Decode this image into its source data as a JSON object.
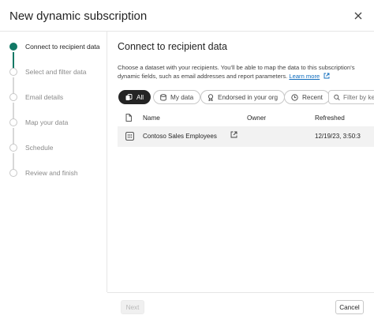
{
  "dialog": {
    "title": "New dynamic subscription",
    "close_icon": "close-icon"
  },
  "steps": [
    {
      "label": "Connect to recipient data",
      "state": "current"
    },
    {
      "label": "Select and filter data",
      "state": "upcoming"
    },
    {
      "label": "Email details",
      "state": "upcoming"
    },
    {
      "label": "Map your data",
      "state": "upcoming"
    },
    {
      "label": "Schedule",
      "state": "upcoming"
    },
    {
      "label": "Review and finish",
      "state": "upcoming"
    }
  ],
  "main": {
    "title": "Connect to recipient data",
    "description": "Choose a dataset with your recipients. You'll be able to map the data to this subscription's dynamic fields, such as email addresses and report parameters.",
    "learn_more": "Learn more",
    "filters": [
      {
        "label": "All",
        "icon": "all-icon",
        "selected": true
      },
      {
        "label": "My data",
        "icon": "database-icon",
        "selected": false
      },
      {
        "label": "Endorsed in your org",
        "icon": "endorsed-icon",
        "selected": false
      },
      {
        "label": "Recent",
        "icon": "clock-icon",
        "selected": false
      }
    ],
    "search_placeholder": "Filter by keyword"
  },
  "table": {
    "columns": [
      "",
      "Name",
      "Owner",
      "Refreshed"
    ],
    "rows": [
      {
        "name": "Contoso Sales Employees",
        "owner": "",
        "refreshed": "12/19/23, 3:50:3"
      }
    ]
  },
  "footer": {
    "next_label": "Next",
    "cancel_label": "Cancel"
  },
  "colors": {
    "accent": "#117865",
    "link": "#0f6cbd",
    "selected_pill": "#242424"
  }
}
